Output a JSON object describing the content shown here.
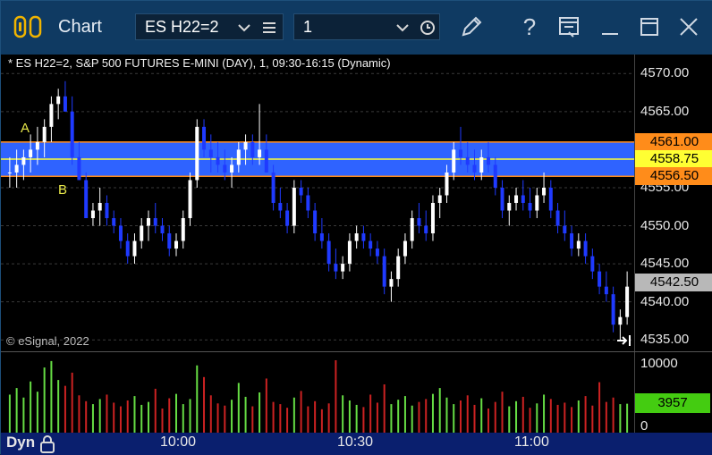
{
  "window": {
    "title": "Chart",
    "symbol_combo": {
      "value": "ES H22=2"
    },
    "interval_combo": {
      "value": "1"
    },
    "buttons": [
      "menu-icon",
      "clock-icon",
      "pencil-icon",
      "help-icon",
      "layout-icon",
      "minimize-icon",
      "maximize-icon",
      "close-icon"
    ]
  },
  "chart": {
    "header": "* ES H22=2, S&P 500 FUTURES E-MINI (DAY), 1, 09:30-16:15 (Dynamic)",
    "copyright": "© eSignal, 2022",
    "price_ticks": [
      "4570.00",
      "4565.00",
      "4560.00",
      "4555.00",
      "4550.00",
      "4545.00",
      "4540.00",
      "4535.00"
    ],
    "price_tick_values": [
      4570,
      4565,
      4560,
      4555,
      4550,
      4545,
      4540,
      4535
    ],
    "levels": [
      {
        "label": "4561.00",
        "value": 4561.0,
        "color": "#ff8c1a"
      },
      {
        "label": "4558.75",
        "value": 4558.75,
        "color": "#ffff33"
      },
      {
        "label": "4556.50",
        "value": 4556.5,
        "color": "#ff8c1a"
      },
      {
        "label": "4542.50",
        "value": 4542.5,
        "color": "#b8b8b8"
      }
    ],
    "marker_labels": {
      "a": "A",
      "b": "B"
    },
    "volume_ticks": [
      "10000",
      "0"
    ],
    "volume_last": {
      "label": "3957",
      "color": "#44cc11"
    },
    "time_ticks": [
      "10:00",
      "10:30",
      "11:00"
    ],
    "dyn_label": "Dyn"
  },
  "chart_data": {
    "type": "candlestick",
    "ylim": [
      4533.5,
      4572.5
    ],
    "band": {
      "top": 4561.0,
      "mid": 4558.75,
      "bottom": 4556.5,
      "color": "#2f63ff"
    },
    "up_color": "#ffffff",
    "down_color": "#1f3aff",
    "candles": [
      [
        4557,
        4559,
        4555,
        4557
      ],
      [
        4557,
        4560,
        4555,
        4558
      ],
      [
        4558,
        4560,
        4556,
        4559
      ],
      [
        4559,
        4562,
        4557,
        4560
      ],
      [
        4560,
        4563,
        4558,
        4561
      ],
      [
        4561,
        4564,
        4559,
        4563
      ],
      [
        4563,
        4567,
        4561,
        4566
      ],
      [
        4566,
        4568,
        4564,
        4567
      ],
      [
        4567,
        4569,
        4565,
        4565
      ],
      [
        4565,
        4567,
        4558,
        4559
      ],
      [
        4559,
        4561,
        4556,
        4556
      ],
      [
        4556,
        4557,
        4551,
        4551
      ],
      [
        4551,
        4553,
        4550,
        4552
      ],
      [
        4552,
        4555,
        4550,
        4553
      ],
      [
        4553,
        4554,
        4550,
        4551
      ],
      [
        4551,
        4552,
        4549,
        4550
      ],
      [
        4550,
        4551,
        4547,
        4548
      ],
      [
        4548,
        4549,
        4545,
        4546
      ],
      [
        4546,
        4549,
        4545,
        4548
      ],
      [
        4548,
        4551,
        4547,
        4550
      ],
      [
        4550,
        4552,
        4548,
        4551
      ],
      [
        4551,
        4553,
        4549,
        4550
      ],
      [
        4550,
        4551,
        4548,
        4549
      ],
      [
        4549,
        4550,
        4546,
        4547
      ],
      [
        4547,
        4549,
        4546,
        4548
      ],
      [
        4548,
        4552,
        4547,
        4551
      ],
      [
        4551,
        4557,
        4550,
        4556
      ],
      [
        4556,
        4564,
        4555,
        4563
      ],
      [
        4563,
        4564,
        4559,
        4560
      ],
      [
        4560,
        4562,
        4557,
        4559
      ],
      [
        4559,
        4561,
        4557,
        4558
      ],
      [
        4558,
        4560,
        4556,
        4557
      ],
      [
        4557,
        4559,
        4555,
        4558
      ],
      [
        4558,
        4561,
        4557,
        4560
      ],
      [
        4560,
        4562,
        4558,
        4561
      ],
      [
        4561,
        4562,
        4558,
        4559
      ],
      [
        4559,
        4566,
        4558,
        4560
      ],
      [
        4560,
        4562,
        4557,
        4557
      ],
      [
        4557,
        4558,
        4552,
        4553
      ],
      [
        4553,
        4555,
        4551,
        4552
      ],
      [
        4552,
        4553,
        4549,
        4550
      ],
      [
        4550,
        4556,
        4549,
        4555
      ],
      [
        4555,
        4556,
        4553,
        4554
      ],
      [
        4554,
        4555,
        4551,
        4552
      ],
      [
        4552,
        4553,
        4548,
        4549
      ],
      [
        4549,
        4551,
        4547,
        4548
      ],
      [
        4548,
        4549,
        4544,
        4545
      ],
      [
        4545,
        4547,
        4543,
        4544
      ],
      [
        4544,
        4546,
        4543,
        4545
      ],
      [
        4545,
        4549,
        4544,
        4548
      ],
      [
        4548,
        4550,
        4547,
        4549
      ],
      [
        4549,
        4550,
        4547,
        4548
      ],
      [
        4548,
        4549,
        4546,
        4547
      ],
      [
        4547,
        4548,
        4545,
        4546
      ],
      [
        4546,
        4547,
        4541,
        4542
      ],
      [
        4542,
        4544,
        4540,
        4543
      ],
      [
        4543,
        4547,
        4542,
        4546
      ],
      [
        4546,
        4549,
        4545,
        4548
      ],
      [
        4548,
        4552,
        4547,
        4551
      ],
      [
        4551,
        4553,
        4549,
        4550
      ],
      [
        4550,
        4552,
        4548,
        4549
      ],
      [
        4549,
        4554,
        4548,
        4553
      ],
      [
        4553,
        4555,
        4551,
        4554
      ],
      [
        4554,
        4558,
        4553,
        4557
      ],
      [
        4557,
        4561,
        4556,
        4560
      ],
      [
        4560,
        4563,
        4558,
        4559
      ],
      [
        4559,
        4561,
        4557,
        4558
      ],
      [
        4558,
        4560,
        4556,
        4557
      ],
      [
        4557,
        4560,
        4556,
        4559
      ],
      [
        4559,
        4561,
        4557,
        4558
      ],
      [
        4558,
        4559,
        4554,
        4555
      ],
      [
        4555,
        4556,
        4551,
        4552
      ],
      [
        4552,
        4554,
        4550,
        4553
      ],
      [
        4553,
        4555,
        4552,
        4554
      ],
      [
        4554,
        4556,
        4552,
        4553
      ],
      [
        4553,
        4555,
        4551,
        4552
      ],
      [
        4552,
        4555,
        4551,
        4554
      ],
      [
        4554,
        4557,
        4553,
        4555
      ],
      [
        4555,
        4556,
        4551,
        4552
      ],
      [
        4552,
        4553,
        4549,
        4550
      ],
      [
        4550,
        4552,
        4548,
        4549
      ],
      [
        4549,
        4550,
        4546,
        4547
      ],
      [
        4547,
        4549,
        4546,
        4548
      ],
      [
        4548,
        4549,
        4545,
        4546
      ],
      [
        4546,
        4547,
        4543,
        4544
      ],
      [
        4544,
        4545,
        4541,
        4542
      ],
      [
        4542,
        4544,
        4540,
        4541
      ],
      [
        4541,
        4542,
        4536,
        4537
      ],
      [
        4537,
        4539,
        4535,
        4538
      ],
      [
        4538,
        4544,
        4537,
        4542
      ]
    ],
    "volume": [
      5200,
      6100,
      4800,
      7000,
      5600,
      8900,
      9800,
      7200,
      6400,
      8200,
      5100,
      4300,
      3900,
      4600,
      5200,
      4100,
      3600,
      4400,
      5000,
      3800,
      4200,
      6000,
      3300,
      4700,
      5300,
      3900,
      4600,
      9200,
      7600,
      5100,
      4000,
      3700,
      4500,
      6800,
      4900,
      3600,
      5500,
      7400,
      4200,
      3900,
      3400,
      4800,
      5700,
      3600,
      4300,
      3200,
      4000,
      9900,
      5100,
      4400,
      3800,
      3500,
      5200,
      4100,
      6600,
      3900,
      4500,
      5000,
      3700,
      4200,
      4600,
      5300,
      6100,
      4800,
      3900,
      4400,
      5100,
      3800,
      4700,
      3300,
      4200,
      5600,
      3600,
      4300,
      4900,
      3400,
      4000,
      5200,
      4600,
      3800,
      4100,
      3500,
      4400,
      5000,
      3700,
      6900,
      4200,
      4800,
      3900,
      3957
    ],
    "volume_ylim": [
      0,
      11000
    ]
  }
}
